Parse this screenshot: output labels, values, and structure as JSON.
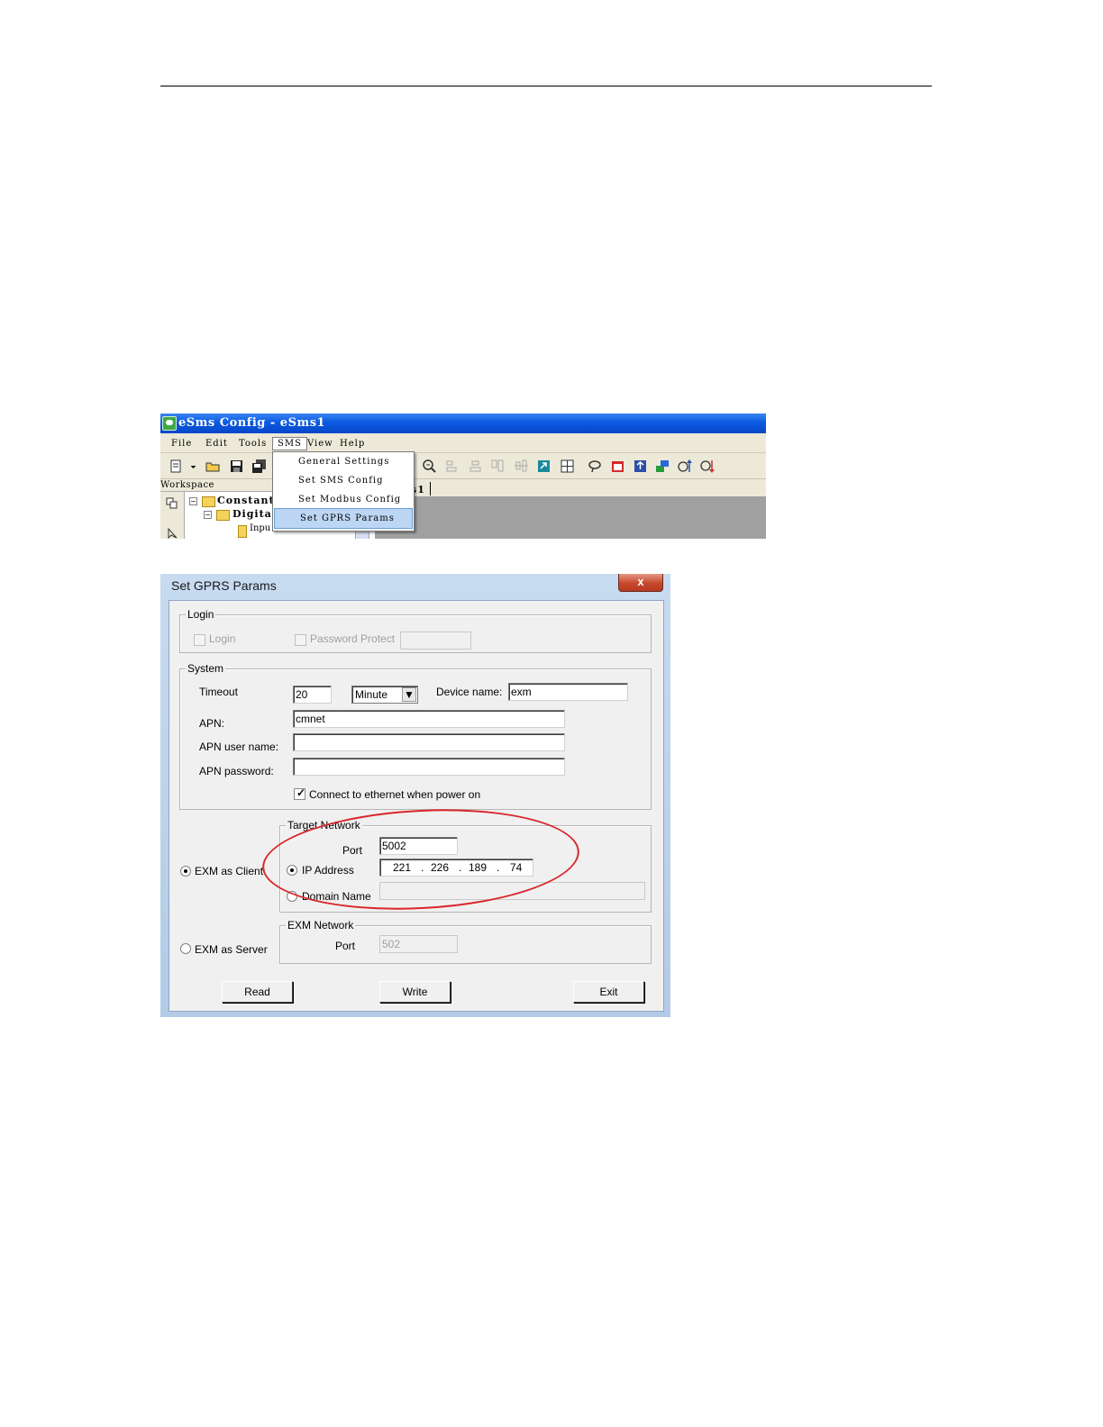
{
  "menu_window": {
    "title": "eSms Config - eSms1",
    "menus": [
      "File",
      "Edit",
      "Tools",
      "SMS",
      "View",
      "Help"
    ],
    "active_menu": "SMS",
    "sms_dropdown": [
      "General Settings",
      "Set SMS Config",
      "Set Modbus Config",
      "Set GPRS Params"
    ],
    "highlighted_item": "Set GPRS Params",
    "workspace_label": "Workspace",
    "tree": {
      "constant": "Constant",
      "digital": "Digita",
      "input": "Inpu"
    },
    "doc_tab_fragment": "s1"
  },
  "dialog": {
    "title": "Set GPRS Params",
    "close_label": "x",
    "login_group": {
      "title": "Login",
      "login_label": "Login",
      "login_checked": false,
      "password_protect_label": "Password Protect",
      "password_protect_checked": false,
      "password_value": ""
    },
    "system_group": {
      "title": "System",
      "timeout_label": "Timeout",
      "timeout_value": "20",
      "timeout_unit": "Minute",
      "device_name_label": "Device name:",
      "device_name_value": "exm",
      "apn_label": "APN:",
      "apn_value": "cmnet",
      "apn_user_label": "APN user name:",
      "apn_user_value": "",
      "apn_password_label": "APN password:",
      "apn_password_value": "",
      "connect_ethernet_label": "Connect to ethernet when power on",
      "connect_ethernet_checked": true
    },
    "mode": {
      "client_label": "EXM as Client",
      "server_label": "EXM as Server",
      "selected": "EXM as Client"
    },
    "target_network": {
      "title": "Target Network",
      "port_label": "Port",
      "port_value": "5002",
      "ip_label": "IP Address",
      "ip_octets": [
        "221",
        "226",
        "189",
        "74"
      ],
      "domain_label": "Domain Name",
      "domain_value": "",
      "selected": "IP Address"
    },
    "exm_network": {
      "title": "EXM Network",
      "port_label": "Port",
      "port_value": "502"
    },
    "buttons": {
      "read": "Read",
      "write": "Write",
      "exit": "Exit"
    },
    "annotation_color": "#d9262a"
  }
}
